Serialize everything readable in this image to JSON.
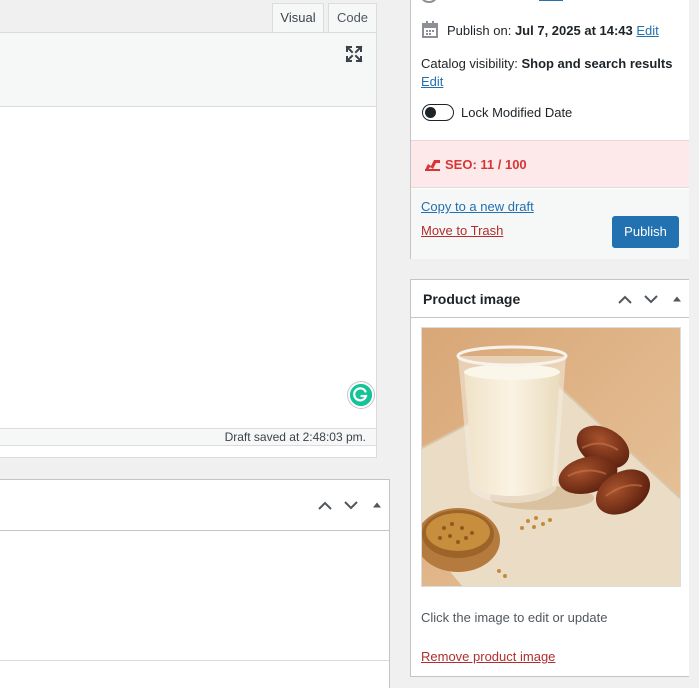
{
  "editor": {
    "tab_visual": "Visual",
    "tab_code": "Code",
    "status_text": "Draft saved at 2:48:03 pm."
  },
  "publish": {
    "schedule_label": "Publish on:",
    "schedule_value": "Jul 7, 2025 at 14:43",
    "schedule_edit": "Edit",
    "visibility_label": "Catalog visibility:",
    "visibility_value": "Shop and search results",
    "visibility_edit": "Edit",
    "lock_label": "Lock Modified Date",
    "lock_enabled": false,
    "seo_label": "SEO: 11 / 100",
    "copy_draft": "Copy to a new draft",
    "move_trash": "Move to Trash",
    "publish_button": "Publish"
  },
  "product_image": {
    "title": "Product image",
    "hint": "Click the image to edit or update",
    "remove": "Remove product image"
  },
  "icons": {
    "fullscreen": "fullscreen-icon",
    "grammarly": "grammarly-icon",
    "calendar": "calendar-icon",
    "seo": "seo-score-icon",
    "move_up": "chevron-up-icon",
    "move_down": "chevron-down-icon",
    "toggle": "triangle-up-icon"
  },
  "colors": {
    "accent": "#2271b1",
    "danger": "#b32d2e",
    "seo_bg": "#fde9e9",
    "seo_text": "#d63638",
    "grammarly": "#15c39a"
  }
}
